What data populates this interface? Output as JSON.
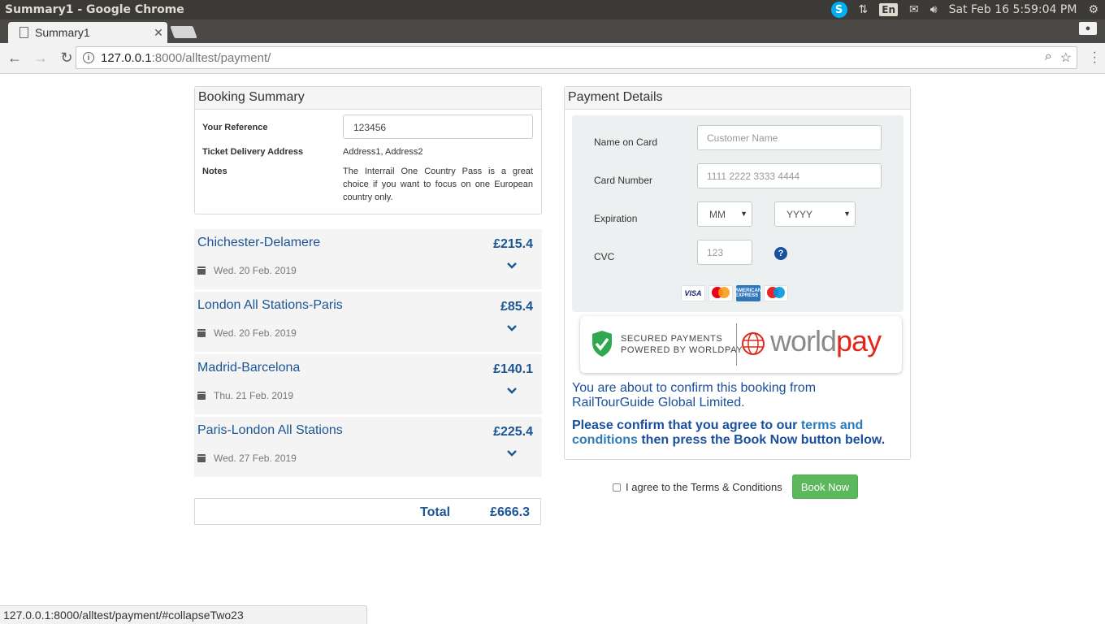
{
  "os": {
    "window_title": "Summary1 - Google Chrome",
    "lang": "En",
    "datetime": "Sat Feb 16  5:59:04 PM"
  },
  "browser": {
    "tab_title": "Summary1",
    "url_host": "127.0.0.1",
    "url_path": ":8000/alltest/payment/",
    "status_url": "127.0.0.1:8000/alltest/payment/#collapseTwo23"
  },
  "booking_summary": {
    "heading": "Booking Summary",
    "reference_label": "Your Reference",
    "reference_value": "123456",
    "delivery_label": "Ticket Delivery Address",
    "delivery_value": "Address1, Address2",
    "notes_label": "Notes",
    "notes_value": "The Interrail One Country Pass is a great choice if you want to focus on one European country only."
  },
  "journeys": [
    {
      "route": "Chichester-Delamere",
      "price": "£215.4",
      "date": "Wed. 20 Feb. 2019"
    },
    {
      "route": "London All Stations-Paris",
      "price": "£85.4",
      "date": "Wed. 20 Feb. 2019"
    },
    {
      "route": "Madrid-Barcelona",
      "price": "£140.1",
      "date": "Thu. 21 Feb. 2019"
    },
    {
      "route": "Paris-London All Stations",
      "price": "£225.4",
      "date": "Wed. 27 Feb. 2019"
    }
  ],
  "total": {
    "label": "Total",
    "value": "£666.3"
  },
  "payment": {
    "heading": "Payment Details",
    "name_label": "Name on Card",
    "name_placeholder": "Customer Name",
    "card_label": "Card Number",
    "card_placeholder": "1111 2222 3333 4444",
    "expiration_label": "Expiration",
    "month_value": "MM",
    "year_value": "YYYY",
    "cvc_label": "CVC",
    "cvc_placeholder": "123",
    "help_glyph": "?",
    "card_visa": "VISA",
    "card_amex": "AMERICAN EXPRESS",
    "secured_line1": "SECURED PAYMENTS",
    "secured_line2": "POWERED BY WORLDPAY",
    "logo_world": "world",
    "logo_pay": "pay",
    "confirm_text": "You are about to confirm this booking from RailTourGuide Global Limited.",
    "agree_prefix": "Please confirm that you agree to our ",
    "terms_link": "terms and conditions",
    "agree_suffix": " then press the Book Now button below."
  },
  "actions": {
    "agree_label": "I agree to the Terms & Conditions",
    "book_now": "Book Now"
  },
  "colors": {
    "brand_blue": "#1a5595",
    "book_green": "#5cb85c",
    "worldpay_red": "#e1261c"
  }
}
